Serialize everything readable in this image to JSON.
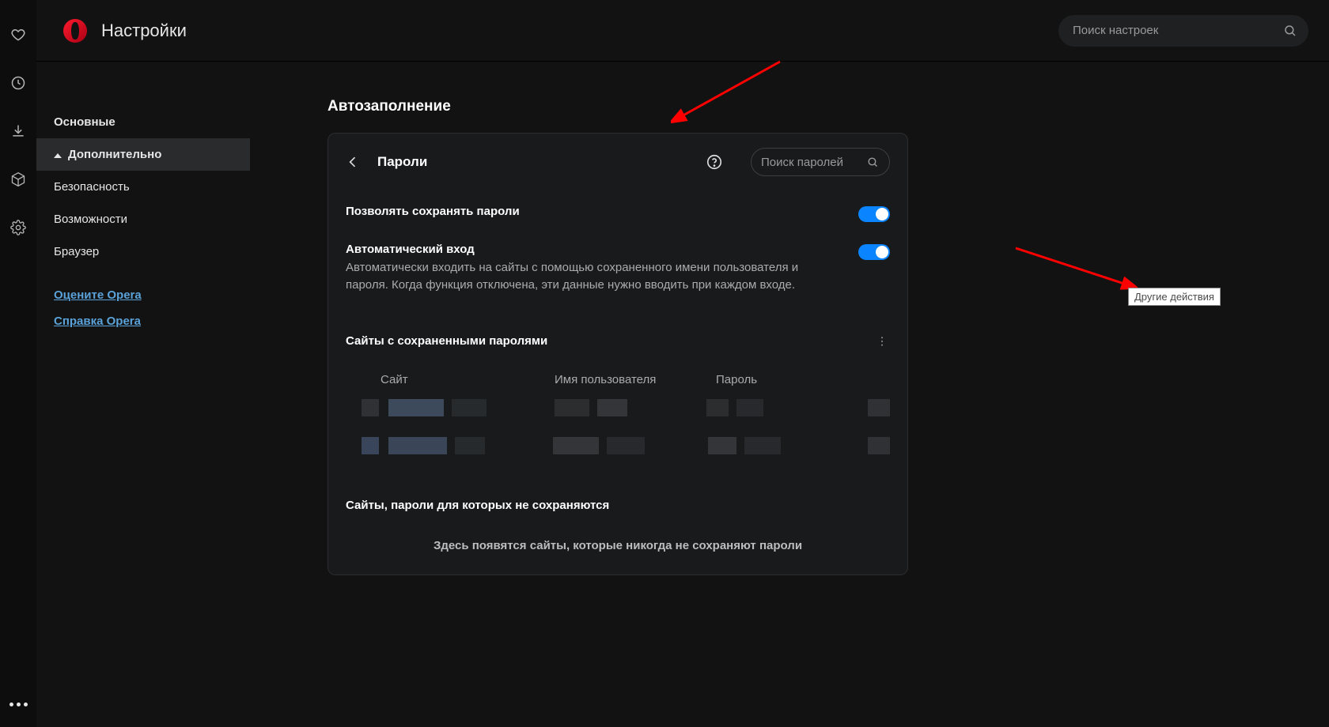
{
  "top": {
    "title": "Настройки",
    "search_placeholder": "Поиск настроек"
  },
  "sidebar": {
    "items": [
      {
        "label": "Основные"
      },
      {
        "label": "Дополнительно"
      },
      {
        "label": "Безопасность"
      },
      {
        "label": "Возможности"
      },
      {
        "label": "Браузер"
      }
    ],
    "links": [
      "Оцените Opera",
      "Справка Opera"
    ]
  },
  "section": {
    "title": "Автозаполнение"
  },
  "card": {
    "title": "Пароли",
    "search_placeholder": "Поиск паролей",
    "settings": [
      {
        "label": "Позволять сохранять пароли",
        "on": true
      },
      {
        "label": "Автоматический вход",
        "desc": "Автоматически входить на сайты с помощью сохраненного имени пользователя и пароля. Когда функция отключена, эти данные нужно вводить при каждом входе.",
        "on": true
      }
    ],
    "saved": {
      "heading": "Сайты с сохраненными паролями",
      "columns": {
        "site": "Сайт",
        "user": "Имя пользователя",
        "pw": "Пароль"
      }
    },
    "never": {
      "heading": "Сайты, пароли для которых не сохраняются",
      "empty": "Здесь появятся сайты, которые никогда не сохраняют пароли"
    }
  },
  "tooltip": "Другие действия"
}
